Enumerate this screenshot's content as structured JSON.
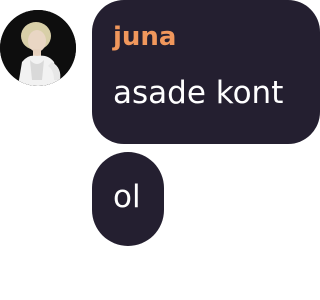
{
  "messages": [
    {
      "author": "juna",
      "text": "asade kont",
      "author_color": "#f0975c"
    },
    {
      "text": "ol"
    }
  ],
  "colors": {
    "bubble_bg": "#241f30",
    "text": "#ffffff",
    "page_bg": "#ffffff"
  },
  "avatar": {
    "icon": "user-avatar-photo"
  }
}
